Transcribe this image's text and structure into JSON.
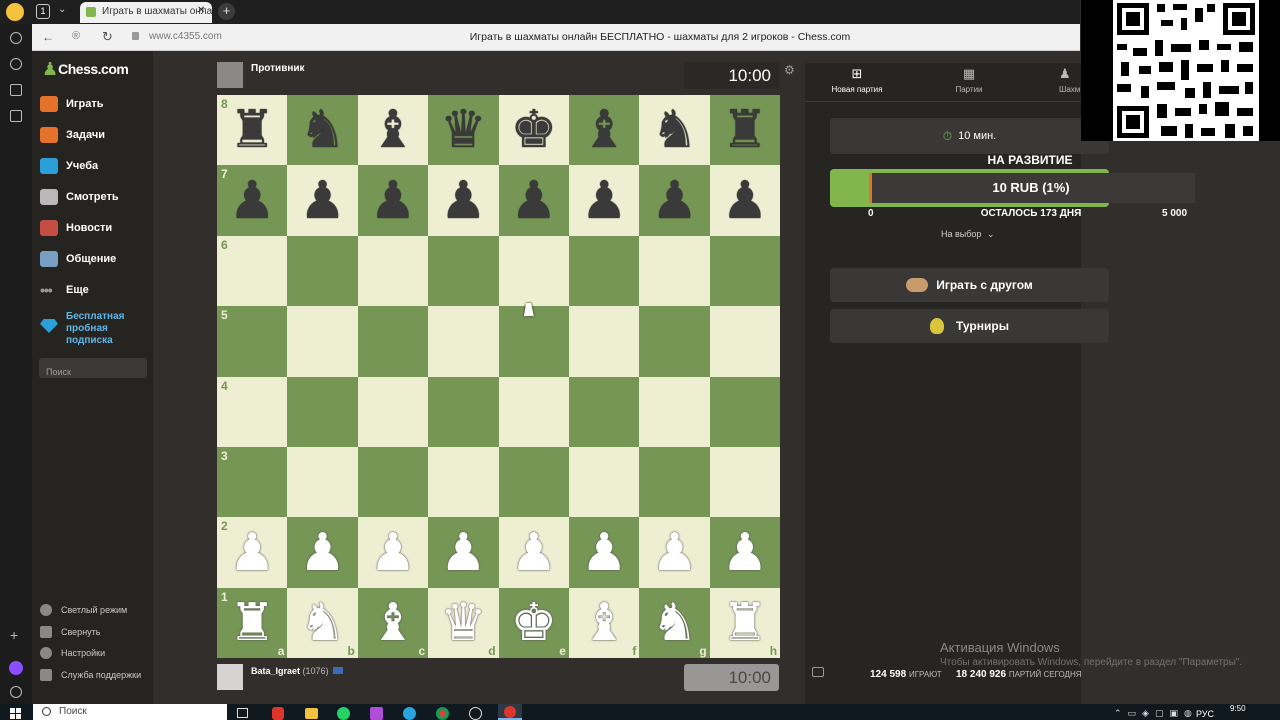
{
  "browser": {
    "tab_title": "Играть в шахматы онлайн",
    "tab_close": "✕",
    "new_tab": "+",
    "tab_counter": "1",
    "url": "www.c4355.com",
    "page_title": "Играть в шахматы онлайн БЕСПЛАТНО - шахматы для 2 игроков - Chess.com"
  },
  "sidebar": {
    "logo": "Chess.com",
    "items": [
      {
        "label": "Играть",
        "color": "#e6712a"
      },
      {
        "label": "Задачи",
        "color": "#e6712a"
      },
      {
        "label": "Учеба",
        "color": "#2a9fd8"
      },
      {
        "label": "Смотреть",
        "color": "#b9b9b9"
      },
      {
        "label": "Новости",
        "color": "#c44e43"
      },
      {
        "label": "Общение",
        "color": "#7a9fc4"
      },
      {
        "label": "Еще",
        "color": "#999999"
      }
    ],
    "promo": "Бесплатная пробная подписка",
    "search_placeholder": "Поиск",
    "bottom": [
      {
        "label": "Светлый режим"
      },
      {
        "label": "Свернуть"
      },
      {
        "label": "Настройки"
      },
      {
        "label": "Служба поддержки"
      }
    ]
  },
  "game": {
    "opponent_name": "Противник",
    "opponent_clock": "10:00",
    "player_name": "Bata_Igraet",
    "player_rating": "(1076)",
    "player_clock": "10:00",
    "ranks": [
      "8",
      "7",
      "6",
      "5",
      "4",
      "3",
      "2",
      "1"
    ],
    "files": [
      "a",
      "b",
      "c",
      "d",
      "e",
      "f",
      "g",
      "h"
    ],
    "board": [
      [
        "♜",
        "♞",
        "♝",
        "♛",
        "♚",
        "♝",
        "♞",
        "♜"
      ],
      [
        "♟",
        "♟",
        "♟",
        "♟",
        "♟",
        "♟",
        "♟",
        "♟"
      ],
      [
        "",
        "",
        "",
        "",
        "",
        "",
        "",
        ""
      ],
      [
        "",
        "",
        "",
        "",
        "",
        "",
        "",
        ""
      ],
      [
        "",
        "",
        "",
        "",
        "",
        "",
        "",
        ""
      ],
      [
        "",
        "",
        "",
        "",
        "",
        "",
        "",
        ""
      ],
      [
        "♟",
        "♟",
        "♟",
        "♟",
        "♟",
        "♟",
        "♟",
        "♟"
      ],
      [
        "♜",
        "♞",
        "♝",
        "♛",
        "♚",
        "♝",
        "♞",
        "♜"
      ]
    ]
  },
  "right_panel": {
    "tabs": [
      {
        "label": "Новая партия",
        "icon": "⊞"
      },
      {
        "label": "Партии",
        "icon": "▦"
      },
      {
        "label": "Шахм",
        "icon": "♟"
      }
    ],
    "time_control": "10 мин.",
    "donation": {
      "title": "НА РАЗВИТИЕ",
      "bar_label": "10 RUB (1%)",
      "progress_percent": 1,
      "min": "0",
      "remaining": "ОСТАЛОСЬ 173 ДНЯ",
      "max": "5 000"
    },
    "choice": "На выбор",
    "play_friend": "Играть с другом",
    "tournaments": "Турниры",
    "playing_count": "124 598",
    "playing_label": "ИГРАЮТ",
    "games_today_count": "18 240 926",
    "games_today_label": "ПАРТИЙ СЕГОДНЯ"
  },
  "windows": {
    "activation_title": "Активация Windows",
    "activation_text": "Чтобы активировать Windows, перейдите в раздел \"Параметры\".",
    "search": "Поиск",
    "lang": "РУС",
    "time": "9:50"
  },
  "colors": {
    "light_square": "#eeeed2",
    "dark_square": "#769656",
    "accent_green": "#81b64c"
  }
}
